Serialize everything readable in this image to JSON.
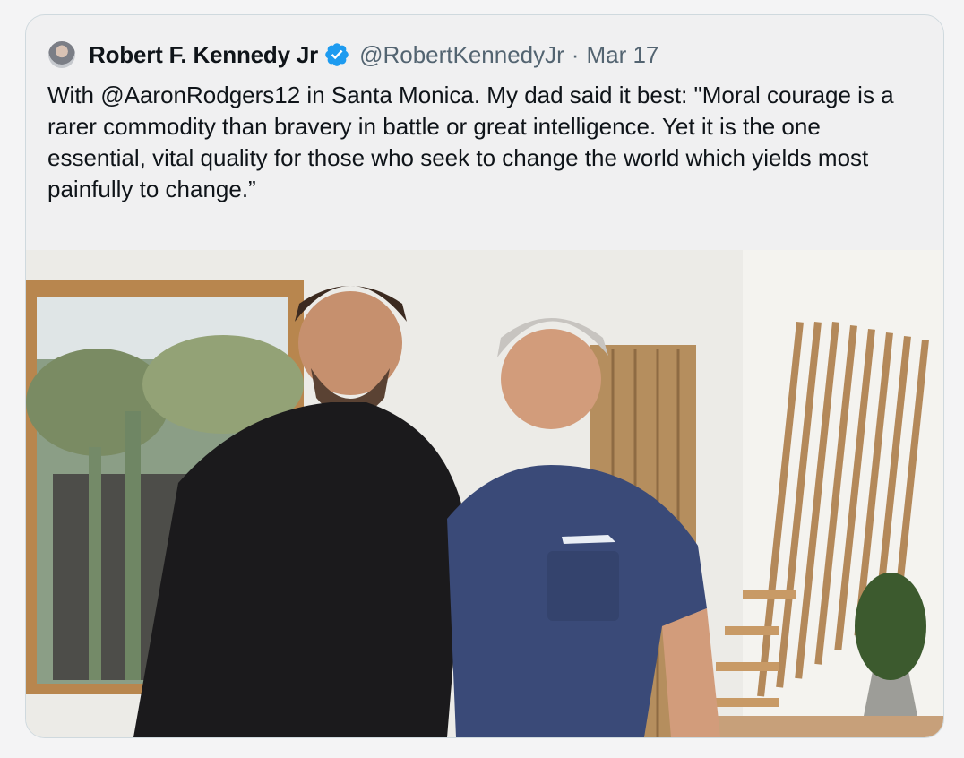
{
  "tweet": {
    "author_name": "Robert F. Kennedy Jr",
    "handle": "@RobertKennedyJr",
    "separator": "·",
    "date": "Mar 17",
    "verified_icon": "verified-badge-icon",
    "text": "With @AaronRodgers12 in Santa Monica. My dad said it best: \"Moral courage is a rarer commodity than bravery in battle or great intelligence. Yet it is the one essential, vital quality for those who seek to change the world which yields most painfully to change.”",
    "photo_alt": "photo"
  },
  "colors": {
    "card_bg": "#f0f0f1",
    "border": "#cfd9de",
    "secondary_text": "#536471",
    "verified_blue": "#1d9bf0"
  }
}
